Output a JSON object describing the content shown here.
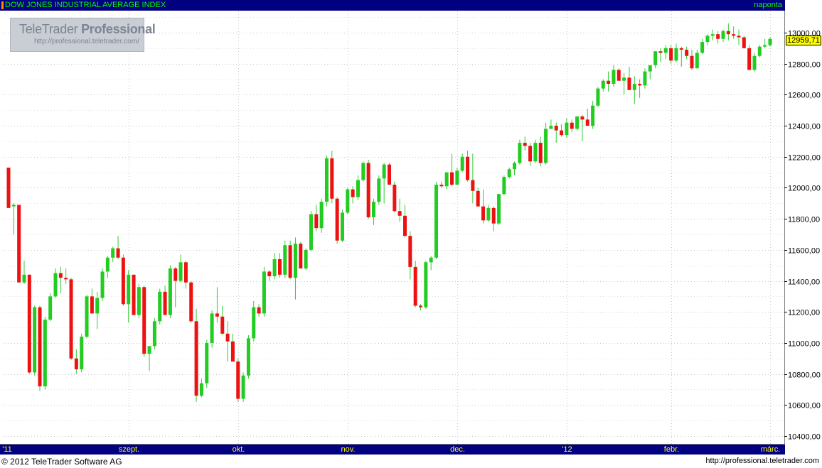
{
  "header": {
    "title": "DOW JONES INDUSTRIAL AVERAGE INDEX",
    "period": "naponta"
  },
  "watermark": {
    "brand": "TeleTrader",
    "product": "Professional",
    "url": "http://professional.teletrader.com/"
  },
  "footer": {
    "copyright": "© 2012 TeleTrader Software AG",
    "url": "http://professional.teletrader.com"
  },
  "colors": {
    "up": "#22cc22",
    "down": "#ee1111",
    "wick": "#33cc33",
    "grid": "#c8c8c8",
    "axis_bar": "#000080",
    "axis_text": "#ffff00",
    "title_text": "#00ff00",
    "last_price_bg": "#ffff00"
  },
  "chart_data": {
    "type": "candlestick",
    "title": "DOW JONES INDUSTRIAL AVERAGE INDEX",
    "period": "naponta",
    "last_price": "12959,71",
    "y_axis": {
      "min": 10400,
      "max": 13100,
      "ticks": [
        10400,
        10600,
        10800,
        11000,
        11200,
        11400,
        11600,
        11800,
        12000,
        12200,
        12400,
        12600,
        12800,
        13000
      ],
      "tick_labels": [
        "10400,00",
        "10600,00",
        "10800,00",
        "11000,00",
        "11200,00",
        "11400,00",
        "11600,00",
        "11800,00",
        "12000,00",
        "12200,00",
        "12400,00",
        "12600,00",
        "12800,00",
        "13000,00"
      ],
      "position": "right"
    },
    "x_axis": {
      "labels": [
        "'11",
        "szept.",
        "okt.",
        "nov.",
        "dec.",
        "'12",
        "febr.",
        "márc."
      ],
      "label_index": [
        0,
        23,
        44,
        65,
        86,
        107,
        127,
        146
      ]
    },
    "grid": true,
    "candles": [
      [
        12130,
        12130,
        11870,
        11870
      ],
      [
        11880,
        11900,
        11700,
        11890
      ],
      [
        11890,
        11890,
        11390,
        11390
      ],
      [
        11390,
        11530,
        11380,
        11440
      ],
      [
        11440,
        11440,
        10800,
        10810
      ],
      [
        10810,
        11240,
        10790,
        11230
      ],
      [
        11230,
        11240,
        10690,
        10720
      ],
      [
        10720,
        11170,
        10700,
        11150
      ],
      [
        11150,
        11320,
        11140,
        11300
      ],
      [
        11300,
        11480,
        11290,
        11450
      ],
      [
        11450,
        11490,
        11320,
        11420
      ],
      [
        11420,
        11480,
        11380,
        11410
      ],
      [
        11410,
        11420,
        10890,
        10900
      ],
      [
        10900,
        10960,
        10800,
        10830
      ],
      [
        10830,
        11060,
        10810,
        11040
      ],
      [
        11040,
        11310,
        11030,
        11300
      ],
      [
        11300,
        11350,
        11190,
        11190
      ],
      [
        11190,
        11330,
        11090,
        11290
      ],
      [
        11290,
        11480,
        11270,
        11460
      ],
      [
        11460,
        11560,
        11420,
        11550
      ],
      [
        11550,
        11620,
        11520,
        11610
      ],
      [
        11610,
        11690,
        11540,
        11550
      ],
      [
        11550,
        11570,
        11240,
        11250
      ],
      [
        11250,
        11470,
        11130,
        11440
      ],
      [
        11440,
        11440,
        11180,
        11180
      ],
      [
        11180,
        11380,
        11160,
        11360
      ],
      [
        11360,
        11370,
        10910,
        10930
      ],
      [
        10930,
        10970,
        10820,
        10980
      ],
      [
        10980,
        11160,
        10960,
        11140
      ],
      [
        11140,
        11350,
        11120,
        11330
      ],
      [
        11330,
        11370,
        11180,
        11180
      ],
      [
        11180,
        11500,
        11160,
        11480
      ],
      [
        11480,
        11490,
        11230,
        11400
      ],
      [
        11400,
        11570,
        11390,
        11520
      ],
      [
        11520,
        11530,
        11350,
        11390
      ],
      [
        11390,
        11400,
        11130,
        11140
      ],
      [
        11140,
        11220,
        10620,
        10660
      ],
      [
        10660,
        10770,
        10650,
        10740
      ],
      [
        10740,
        11020,
        10710,
        11000
      ],
      [
        11000,
        11210,
        10970,
        11190
      ],
      [
        11190,
        11360,
        11130,
        11170
      ],
      [
        11170,
        11240,
        11050,
        11060
      ],
      [
        11060,
        11140,
        10880,
        11010
      ],
      [
        11010,
        11060,
        10890,
        10880
      ],
      [
        10880,
        10900,
        10620,
        10640
      ],
      [
        10640,
        10810,
        10620,
        10790
      ],
      [
        10790,
        11050,
        10770,
        11030
      ],
      [
        11030,
        11270,
        11010,
        11230
      ],
      [
        11230,
        11250,
        11170,
        11190
      ],
      [
        11190,
        11490,
        11170,
        11460
      ],
      [
        11460,
        11470,
        11400,
        11430
      ],
      [
        11430,
        11580,
        11410,
        11540
      ],
      [
        11540,
        11580,
        11420,
        11440
      ],
      [
        11440,
        11660,
        11420,
        11630
      ],
      [
        11630,
        11660,
        11410,
        11420
      ],
      [
        11420,
        11680,
        11280,
        11640
      ],
      [
        11640,
        11650,
        11480,
        11480
      ],
      [
        11480,
        11610,
        11470,
        11600
      ],
      [
        11600,
        11850,
        11590,
        11830
      ],
      [
        11830,
        11890,
        11720,
        11740
      ],
      [
        11740,
        11930,
        11710,
        11910
      ],
      [
        11910,
        12210,
        11880,
        12190
      ],
      [
        12190,
        12240,
        11900,
        11930
      ],
      [
        11930,
        11940,
        11640,
        11660
      ],
      [
        11660,
        11860,
        11650,
        11840
      ],
      [
        11840,
        12000,
        11830,
        11990
      ],
      [
        11990,
        12010,
        11900,
        11940
      ],
      [
        11940,
        12080,
        11920,
        12050
      ],
      [
        12050,
        12170,
        12040,
        12160
      ],
      [
        12160,
        12180,
        11800,
        11810
      ],
      [
        11810,
        11930,
        11760,
        11910
      ],
      [
        11910,
        12080,
        11890,
        12060
      ],
      [
        12060,
        12160,
        11900,
        12150
      ],
      [
        12150,
        12160,
        12020,
        12020
      ],
      [
        12020,
        12040,
        11840,
        11850
      ],
      [
        11850,
        11930,
        11780,
        11820
      ],
      [
        11820,
        11890,
        11680,
        11690
      ],
      [
        11690,
        11720,
        11410,
        11490
      ],
      [
        11490,
        11530,
        11230,
        11240
      ],
      [
        11240,
        11250,
        11210,
        11230
      ],
      [
        11230,
        11530,
        11220,
        11520
      ],
      [
        11520,
        11560,
        11470,
        11550
      ],
      [
        11550,
        12040,
        11540,
        12020
      ],
      [
        12020,
        12040,
        12000,
        12010
      ],
      [
        12010,
        12100,
        11990,
        12100
      ],
      [
        12100,
        12220,
        12010,
        12020
      ],
      [
        12020,
        12130,
        12020,
        12110
      ],
      [
        12110,
        12220,
        12100,
        12200
      ],
      [
        12200,
        12240,
        12040,
        12050
      ],
      [
        12050,
        12220,
        11900,
        11980
      ],
      [
        11980,
        12000,
        11880,
        11880
      ],
      [
        11880,
        11990,
        11770,
        11790
      ],
      [
        11790,
        11890,
        11780,
        11870
      ],
      [
        11870,
        11880,
        11720,
        11770
      ],
      [
        11770,
        11960,
        11760,
        11960
      ],
      [
        11960,
        12080,
        11950,
        12070
      ],
      [
        12070,
        12130,
        12060,
        12120
      ],
      [
        12120,
        12170,
        12080,
        12160
      ],
      [
        12160,
        12310,
        12150,
        12290
      ],
      [
        12290,
        12330,
        12240,
        12270
      ],
      [
        12270,
        12290,
        12140,
        12170
      ],
      [
        12170,
        12310,
        12160,
        12290
      ],
      [
        12290,
        12330,
        12140,
        12160
      ],
      [
        12160,
        12420,
        12150,
        12380
      ],
      [
        12380,
        12440,
        12380,
        12400
      ],
      [
        12400,
        12420,
        12290,
        12370
      ],
      [
        12370,
        12410,
        12330,
        12340
      ],
      [
        12340,
        12450,
        12320,
        12420
      ],
      [
        12420,
        12440,
        12360,
        12380
      ],
      [
        12380,
        12460,
        12370,
        12460
      ],
      [
        12460,
        12470,
        12300,
        12440
      ],
      [
        12440,
        12510,
        12400,
        12400
      ],
      [
        12400,
        12560,
        12380,
        12530
      ],
      [
        12530,
        12650,
        12520,
        12640
      ],
      [
        12640,
        12700,
        12620,
        12690
      ],
      [
        12690,
        12750,
        12620,
        12670
      ],
      [
        12670,
        12790,
        12650,
        12760
      ],
      [
        12760,
        12770,
        12690,
        12690
      ],
      [
        12690,
        12740,
        12600,
        12710
      ],
      [
        12710,
        12780,
        12640,
        12630
      ],
      [
        12630,
        12720,
        12540,
        12670
      ],
      [
        12670,
        12700,
        12580,
        12660
      ],
      [
        12660,
        12770,
        12640,
        12750
      ],
      [
        12750,
        12790,
        12700,
        12790
      ],
      [
        12790,
        12880,
        12770,
        12880
      ],
      [
        12880,
        12900,
        12810,
        12870
      ],
      [
        12870,
        12920,
        12830,
        12900
      ],
      [
        12900,
        12920,
        12800,
        12820
      ],
      [
        12820,
        12930,
        12810,
        12900
      ],
      [
        12900,
        12910,
        12780,
        12890
      ],
      [
        12890,
        12910,
        12830,
        12850
      ],
      [
        12850,
        12890,
        12760,
        12770
      ],
      [
        12770,
        12890,
        12770,
        12870
      ],
      [
        12870,
        12960,
        12860,
        12940
      ],
      [
        12940,
        12990,
        12920,
        12980
      ],
      [
        12980,
        13020,
        12950,
        12990
      ],
      [
        12990,
        13010,
        12930,
        12960
      ],
      [
        12960,
        13020,
        12940,
        13010
      ],
      [
        13010,
        13060,
        12950,
        12990
      ],
      [
        12990,
        13040,
        12960,
        12980
      ],
      [
        12980,
        13020,
        12920,
        12970
      ],
      [
        12970,
        12980,
        12900,
        12900
      ],
      [
        12900,
        12920,
        12760,
        12760
      ],
      [
        12760,
        12870,
        12750,
        12850
      ],
      [
        12850,
        12920,
        12840,
        12910
      ],
      [
        12910,
        12960,
        12900,
        12920
      ],
      [
        12920,
        12970,
        12910,
        12960
      ]
    ]
  }
}
